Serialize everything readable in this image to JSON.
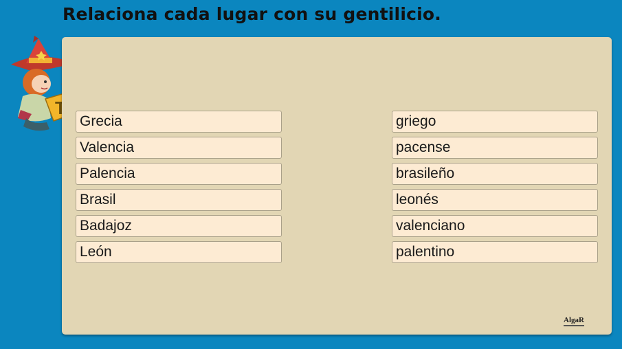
{
  "title": "Relaciona cada lugar con su gentilicio.",
  "places": [
    "Grecia",
    "Valencia",
    "Palencia",
    "Brasil",
    "Badajoz",
    "León"
  ],
  "demonyms": [
    "griego",
    "pacense",
    "brasileño",
    "leonés",
    "valenciano",
    "palentino"
  ],
  "logo_text": "AlgaR",
  "mascot_book_letter": "T"
}
